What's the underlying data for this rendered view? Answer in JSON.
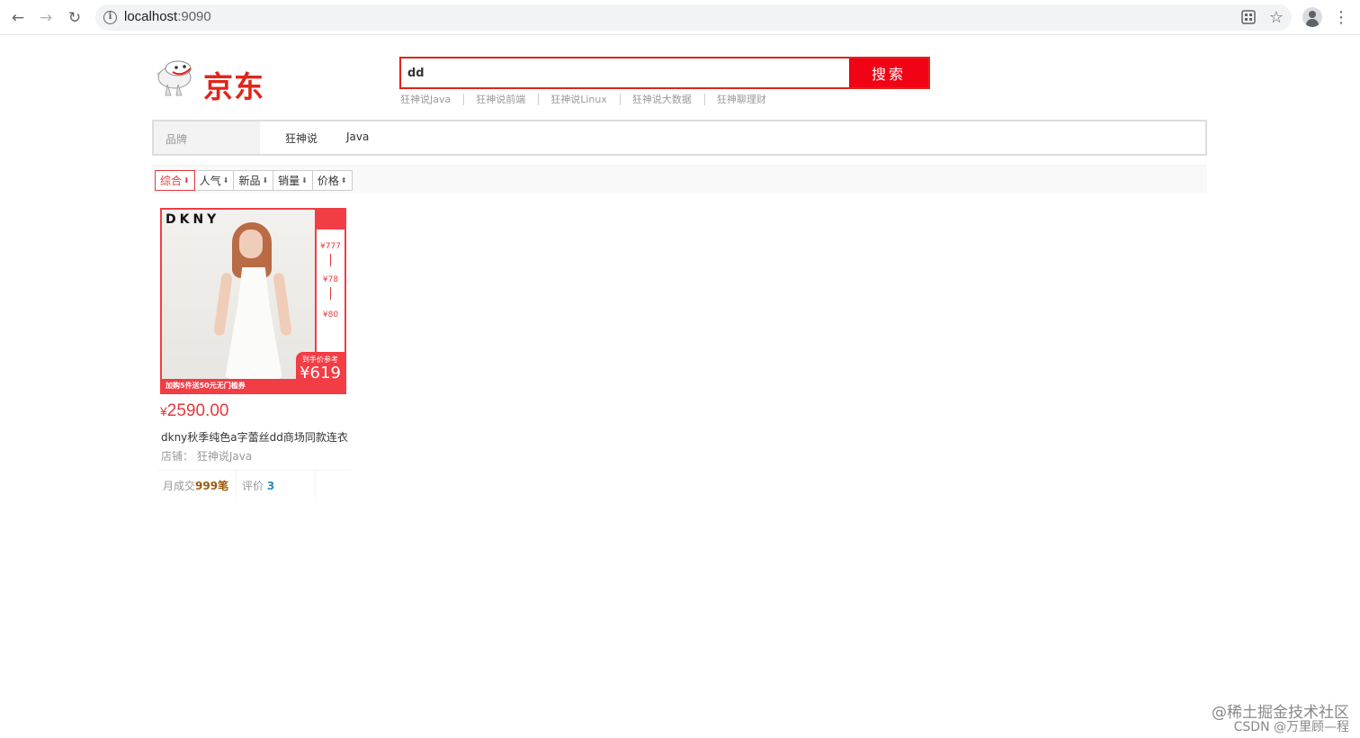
{
  "browser": {
    "url_host": "localhost",
    "url_port": ":9090"
  },
  "header": {
    "logo_text": "京东",
    "search_value": "dd",
    "search_button": "搜索",
    "hot_words": [
      "狂神说Java",
      "狂神说前端",
      "狂神说Linux",
      "狂神说大数据",
      "狂神聊理财"
    ]
  },
  "brand_filter": {
    "label": "品牌",
    "items": [
      "狂神说",
      "Java"
    ]
  },
  "sort_bar": {
    "options": [
      {
        "label": "综合",
        "arrow": "⬇",
        "active": true
      },
      {
        "label": "人气",
        "arrow": "⬇",
        "active": false
      },
      {
        "label": "新品",
        "arrow": "⬇",
        "active": false
      },
      {
        "label": "销量",
        "arrow": "⬇",
        "active": false
      },
      {
        "label": "价格",
        "arrow": "⬍",
        "active": false
      }
    ]
  },
  "product": {
    "image_brand": "DKNY",
    "side_values": [
      "¥777",
      "¥78",
      "¥80"
    ],
    "banner_text": "加购5件送50元无门槛券",
    "tag_label": "到手价参考",
    "tag_value": "¥619",
    "currency": "¥",
    "price": "2590.00",
    "title": "dkny秋季纯色a字蕾丝dd商场同款连衣",
    "shop_label": "店铺：",
    "shop_name": "狂神说Java",
    "sales_label": "月成交",
    "sales_value": "999笔",
    "reviews_label": "评价",
    "reviews_value": "3"
  },
  "watermark": {
    "line1": "@稀土掘金技术社区",
    "line2": "CSDN @万里顾—程"
  },
  "colors": {
    "brand_red": "#e1251b",
    "search_red": "#f10215",
    "price_red": "#e4393c"
  }
}
